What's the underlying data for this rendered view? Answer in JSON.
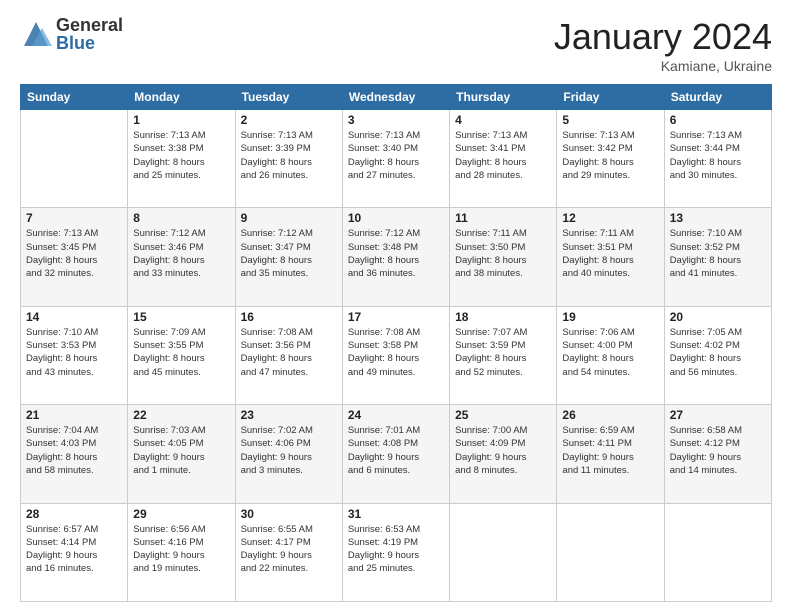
{
  "logo": {
    "general": "General",
    "blue": "Blue"
  },
  "header": {
    "month": "January 2024",
    "location": "Kamiane, Ukraine"
  },
  "weekdays": [
    "Sunday",
    "Monday",
    "Tuesday",
    "Wednesday",
    "Thursday",
    "Friday",
    "Saturday"
  ],
  "weeks": [
    [
      {
        "day": "",
        "info": ""
      },
      {
        "day": "1",
        "info": "Sunrise: 7:13 AM\nSunset: 3:38 PM\nDaylight: 8 hours\nand 25 minutes."
      },
      {
        "day": "2",
        "info": "Sunrise: 7:13 AM\nSunset: 3:39 PM\nDaylight: 8 hours\nand 26 minutes."
      },
      {
        "day": "3",
        "info": "Sunrise: 7:13 AM\nSunset: 3:40 PM\nDaylight: 8 hours\nand 27 minutes."
      },
      {
        "day": "4",
        "info": "Sunrise: 7:13 AM\nSunset: 3:41 PM\nDaylight: 8 hours\nand 28 minutes."
      },
      {
        "day": "5",
        "info": "Sunrise: 7:13 AM\nSunset: 3:42 PM\nDaylight: 8 hours\nand 29 minutes."
      },
      {
        "day": "6",
        "info": "Sunrise: 7:13 AM\nSunset: 3:44 PM\nDaylight: 8 hours\nand 30 minutes."
      }
    ],
    [
      {
        "day": "7",
        "info": "Sunrise: 7:13 AM\nSunset: 3:45 PM\nDaylight: 8 hours\nand 32 minutes."
      },
      {
        "day": "8",
        "info": "Sunrise: 7:12 AM\nSunset: 3:46 PM\nDaylight: 8 hours\nand 33 minutes."
      },
      {
        "day": "9",
        "info": "Sunrise: 7:12 AM\nSunset: 3:47 PM\nDaylight: 8 hours\nand 35 minutes."
      },
      {
        "day": "10",
        "info": "Sunrise: 7:12 AM\nSunset: 3:48 PM\nDaylight: 8 hours\nand 36 minutes."
      },
      {
        "day": "11",
        "info": "Sunrise: 7:11 AM\nSunset: 3:50 PM\nDaylight: 8 hours\nand 38 minutes."
      },
      {
        "day": "12",
        "info": "Sunrise: 7:11 AM\nSunset: 3:51 PM\nDaylight: 8 hours\nand 40 minutes."
      },
      {
        "day": "13",
        "info": "Sunrise: 7:10 AM\nSunset: 3:52 PM\nDaylight: 8 hours\nand 41 minutes."
      }
    ],
    [
      {
        "day": "14",
        "info": "Sunrise: 7:10 AM\nSunset: 3:53 PM\nDaylight: 8 hours\nand 43 minutes."
      },
      {
        "day": "15",
        "info": "Sunrise: 7:09 AM\nSunset: 3:55 PM\nDaylight: 8 hours\nand 45 minutes."
      },
      {
        "day": "16",
        "info": "Sunrise: 7:08 AM\nSunset: 3:56 PM\nDaylight: 8 hours\nand 47 minutes."
      },
      {
        "day": "17",
        "info": "Sunrise: 7:08 AM\nSunset: 3:58 PM\nDaylight: 8 hours\nand 49 minutes."
      },
      {
        "day": "18",
        "info": "Sunrise: 7:07 AM\nSunset: 3:59 PM\nDaylight: 8 hours\nand 52 minutes."
      },
      {
        "day": "19",
        "info": "Sunrise: 7:06 AM\nSunset: 4:00 PM\nDaylight: 8 hours\nand 54 minutes."
      },
      {
        "day": "20",
        "info": "Sunrise: 7:05 AM\nSunset: 4:02 PM\nDaylight: 8 hours\nand 56 minutes."
      }
    ],
    [
      {
        "day": "21",
        "info": "Sunrise: 7:04 AM\nSunset: 4:03 PM\nDaylight: 8 hours\nand 58 minutes."
      },
      {
        "day": "22",
        "info": "Sunrise: 7:03 AM\nSunset: 4:05 PM\nDaylight: 9 hours\nand 1 minute."
      },
      {
        "day": "23",
        "info": "Sunrise: 7:02 AM\nSunset: 4:06 PM\nDaylight: 9 hours\nand 3 minutes."
      },
      {
        "day": "24",
        "info": "Sunrise: 7:01 AM\nSunset: 4:08 PM\nDaylight: 9 hours\nand 6 minutes."
      },
      {
        "day": "25",
        "info": "Sunrise: 7:00 AM\nSunset: 4:09 PM\nDaylight: 9 hours\nand 8 minutes."
      },
      {
        "day": "26",
        "info": "Sunrise: 6:59 AM\nSunset: 4:11 PM\nDaylight: 9 hours\nand 11 minutes."
      },
      {
        "day": "27",
        "info": "Sunrise: 6:58 AM\nSunset: 4:12 PM\nDaylight: 9 hours\nand 14 minutes."
      }
    ],
    [
      {
        "day": "28",
        "info": "Sunrise: 6:57 AM\nSunset: 4:14 PM\nDaylight: 9 hours\nand 16 minutes."
      },
      {
        "day": "29",
        "info": "Sunrise: 6:56 AM\nSunset: 4:16 PM\nDaylight: 9 hours\nand 19 minutes."
      },
      {
        "day": "30",
        "info": "Sunrise: 6:55 AM\nSunset: 4:17 PM\nDaylight: 9 hours\nand 22 minutes."
      },
      {
        "day": "31",
        "info": "Sunrise: 6:53 AM\nSunset: 4:19 PM\nDaylight: 9 hours\nand 25 minutes."
      },
      {
        "day": "",
        "info": ""
      },
      {
        "day": "",
        "info": ""
      },
      {
        "day": "",
        "info": ""
      }
    ]
  ]
}
